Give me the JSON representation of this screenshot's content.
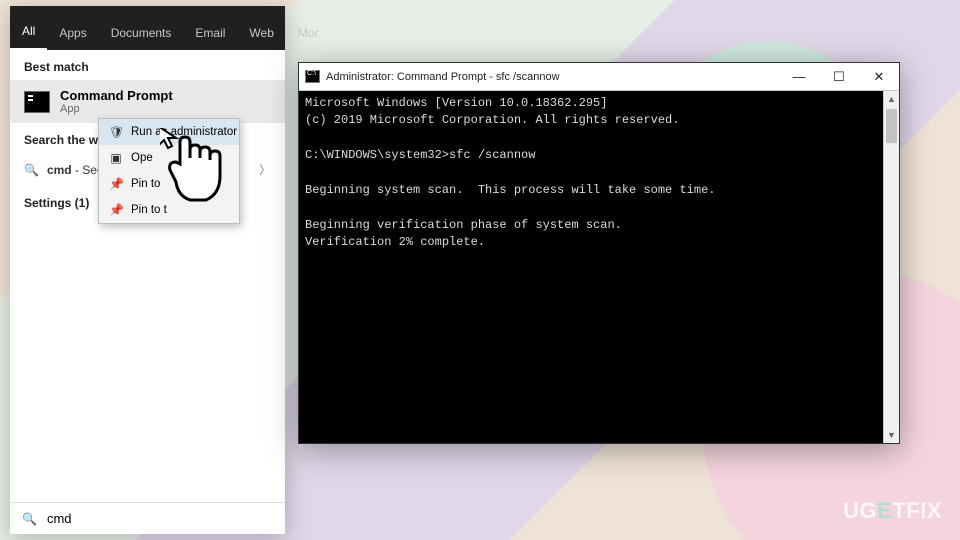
{
  "watermark": {
    "pre": "UG",
    "mid": "E",
    "post": "TFIX"
  },
  "start": {
    "tabs": [
      "All",
      "Apps",
      "Documents",
      "Email",
      "Web",
      "More"
    ],
    "tabs_visible": [
      "All",
      "Apps",
      "Documents",
      "Email",
      "Web",
      "Mor"
    ],
    "active_tab": 0,
    "best_match_header": "Best match",
    "best_match": {
      "title": "Command Prompt",
      "subtitle": "App"
    },
    "search_web_header": "Search the web",
    "web_row": {
      "prefix": "cmd",
      "suffix": " - See w"
    },
    "settings_header": "Settings (1)",
    "search_value": "cmd"
  },
  "context_menu": {
    "items": [
      {
        "icon": "run-admin-icon",
        "label": "Run as administrator",
        "hover": true
      },
      {
        "icon": "open-location-icon",
        "label": "Open file location",
        "label_visible": "Ope"
      },
      {
        "icon": "pin-icon",
        "label": "Pin to Start",
        "label_visible": "Pin to"
      },
      {
        "icon": "pin-icon",
        "label": "Pin to taskbar",
        "label_visible": "Pin to t"
      }
    ]
  },
  "cmd": {
    "title": "Administrator: Command Prompt - sfc  /scannow",
    "lines": [
      "Microsoft Windows [Version 10.0.18362.295]",
      "(c) 2019 Microsoft Corporation. All rights reserved.",
      "",
      "C:\\WINDOWS\\system32>sfc /scannow",
      "",
      "Beginning system scan.  This process will take some time.",
      "",
      "Beginning verification phase of system scan.",
      "Verification 2% complete."
    ]
  }
}
